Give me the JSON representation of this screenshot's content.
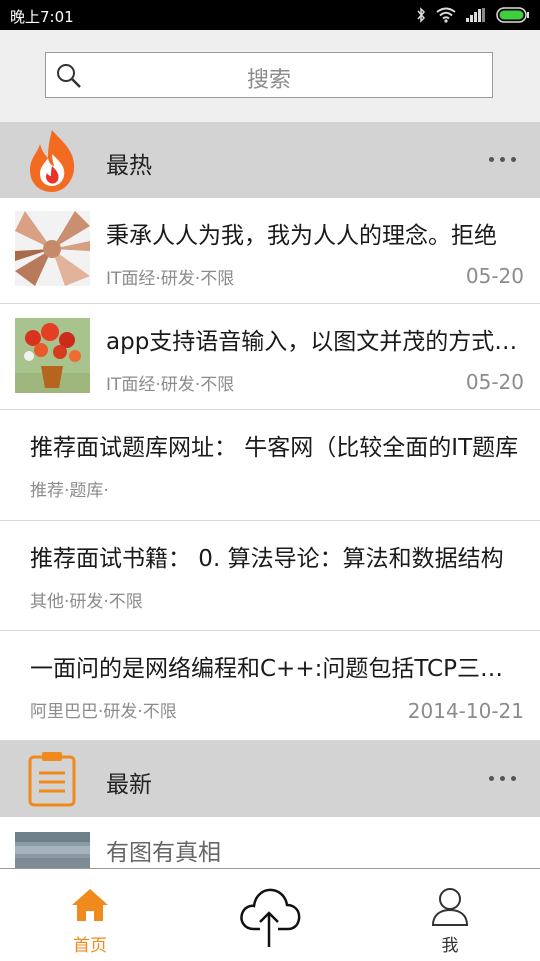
{
  "status_bar": {
    "time": "晚上7:01"
  },
  "search": {
    "placeholder": "搜索"
  },
  "sections": {
    "hot": {
      "title": "最热"
    },
    "new": {
      "title": "最新"
    }
  },
  "hot_items": [
    {
      "title": "秉承人人为我，我为人人的理念。拒绝",
      "meta": "IT面经·研发·不限",
      "date": "05-20"
    },
    {
      "title": "app支持语音输入，以图文并茂的方式展示",
      "meta": "IT面经·研发·不限",
      "date": "05-20"
    },
    {
      "title": "推荐面试题库网址： 牛客网（比较全面的IT题库",
      "meta": "推荐·题库·",
      "date": ""
    },
    {
      "title": "推荐面试书籍： 0. 算法导论：算法和数据结构",
      "meta": "其他·研发·不限",
      "date": ""
    },
    {
      "title": "一面问的是网络编程和C++:问题包括TCP三次握手",
      "meta": "阿里巴巴·研发·不限",
      "date": "2014-10-21"
    }
  ],
  "new_items": [
    {
      "title": "有图有真相"
    }
  ],
  "bottom_nav": {
    "home": "首页",
    "upload": "",
    "me": "我"
  },
  "colors": {
    "accent": "#f08a1c",
    "section_bg": "#d3d3d3",
    "search_bg": "#efefef"
  }
}
